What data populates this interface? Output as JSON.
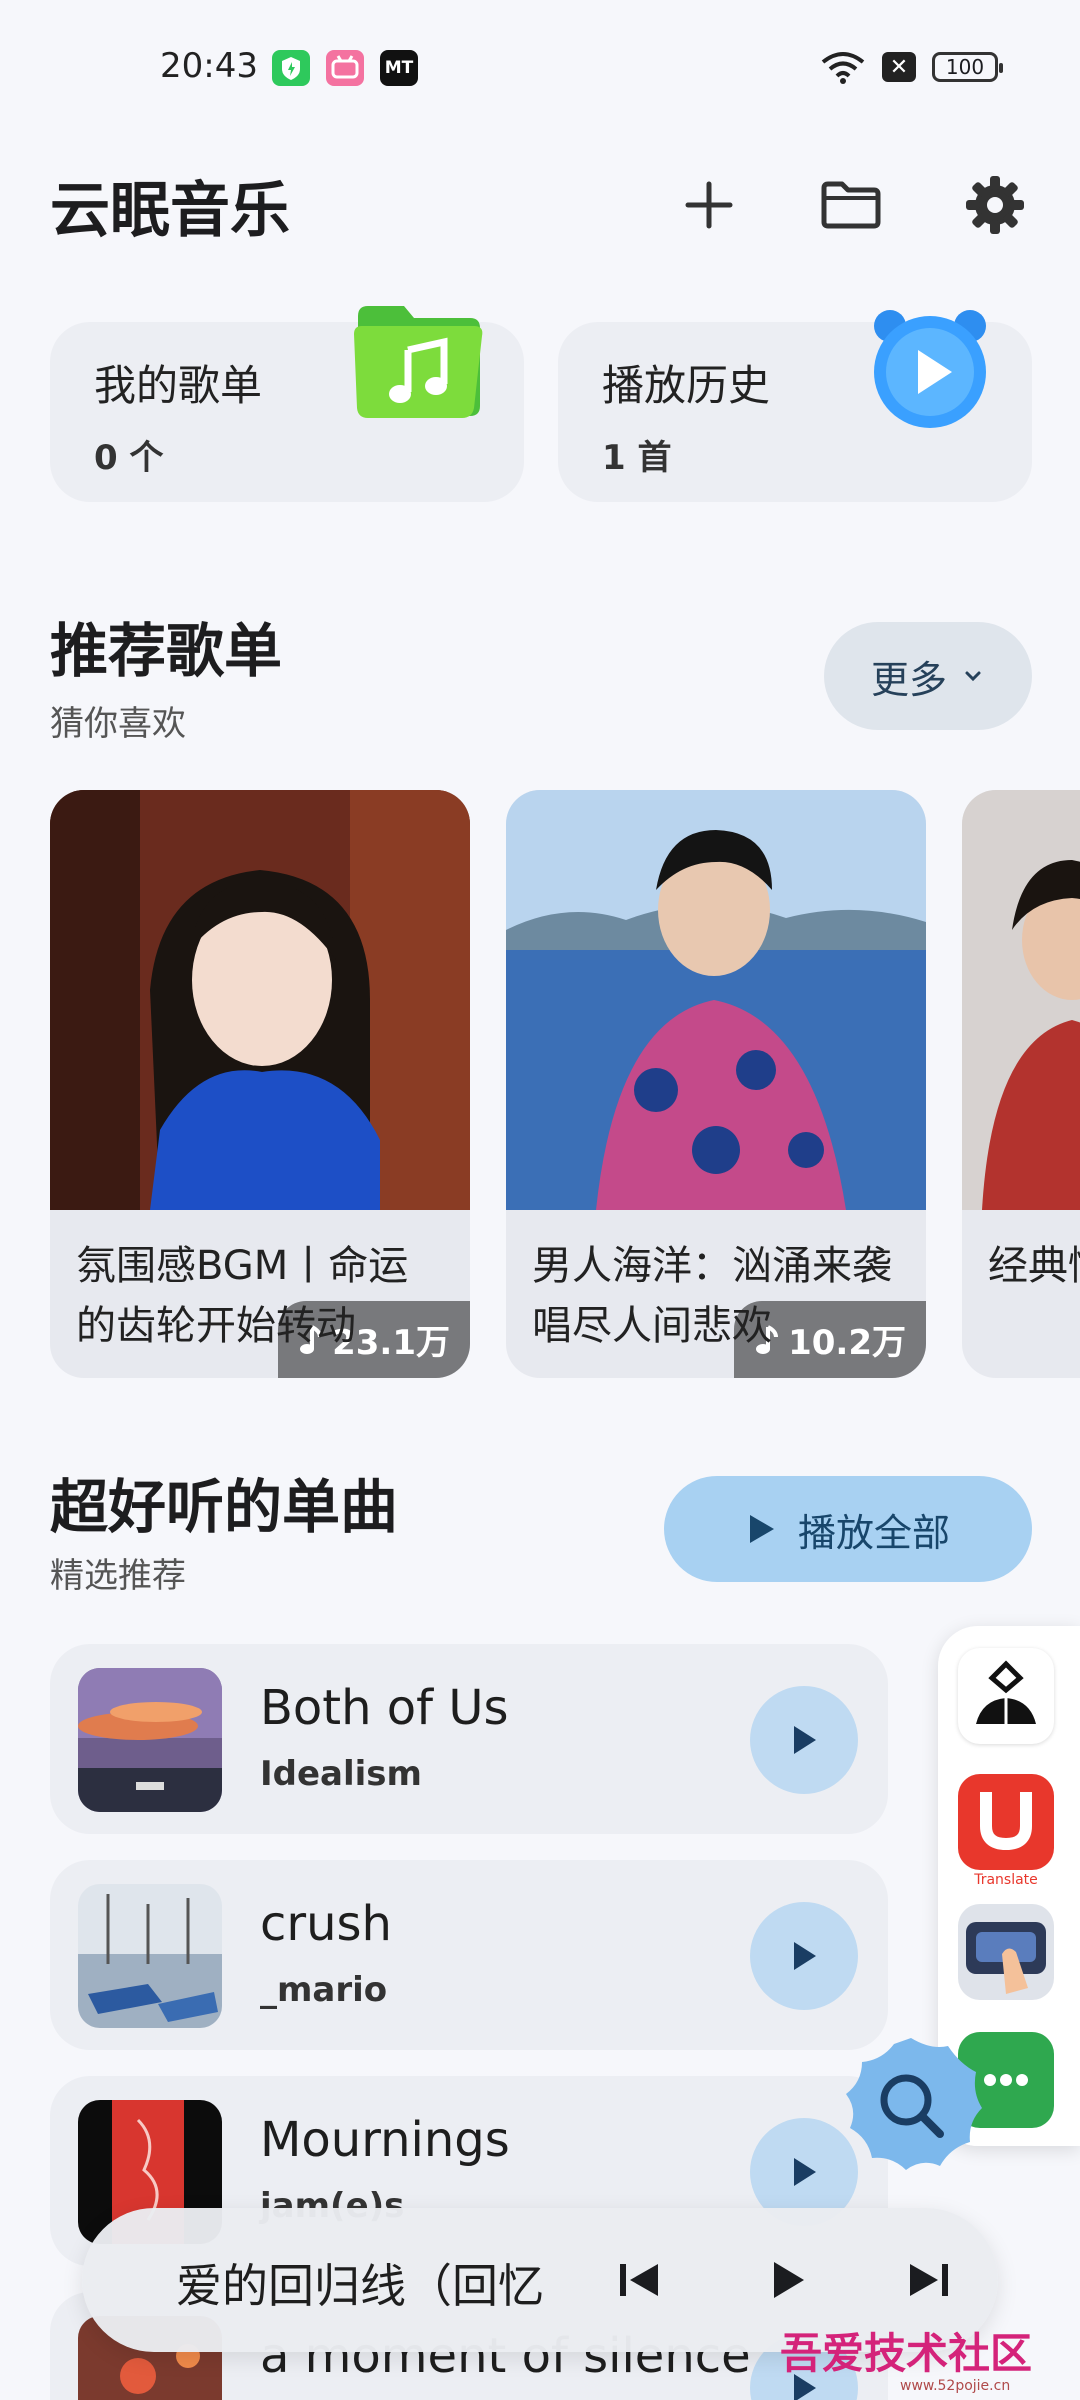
{
  "status_bar": {
    "time": "20:43",
    "battery": "100"
  },
  "header": {
    "title": "云眠音乐"
  },
  "cards": [
    {
      "title": "我的歌单",
      "count": "0 个"
    },
    {
      "title": "播放历史",
      "count": "1 首"
    }
  ],
  "recommend": {
    "title": "推荐歌单",
    "subtitle": "猜你喜欢",
    "more_label": "更多",
    "playlists": [
      {
        "name": "氛围感BGM丨命运的齿轮开始转动",
        "plays": "23.1万"
      },
      {
        "name": "男人海洋：汹涌来袭唱尽人间悲欢",
        "plays": "10.2万"
      },
      {
        "name": "经典情集忆往"
      }
    ]
  },
  "singles": {
    "title": "超好听的单曲",
    "subtitle": "精选推荐",
    "play_all_label": "播放全部",
    "songs": [
      {
        "title": "Both of Us",
        "artist": "Idealism"
      },
      {
        "title": "crush",
        "artist": "_mario"
      },
      {
        "title": "Mournings",
        "artist": "jam(e)s"
      },
      {
        "title": "a moment of silence",
        "artist": ""
      }
    ]
  },
  "side_panel": {
    "translate_label": "Translate"
  },
  "mini_player": {
    "now_playing": "爱的回归线（回忆"
  },
  "watermark": {
    "text": "吾爱技术社区",
    "sub": "www.52pojie.cn"
  },
  "colors": {
    "accent": "#a8d1f2",
    "play_btn": "#bfdaf2",
    "card_bg": "#eceef3"
  }
}
